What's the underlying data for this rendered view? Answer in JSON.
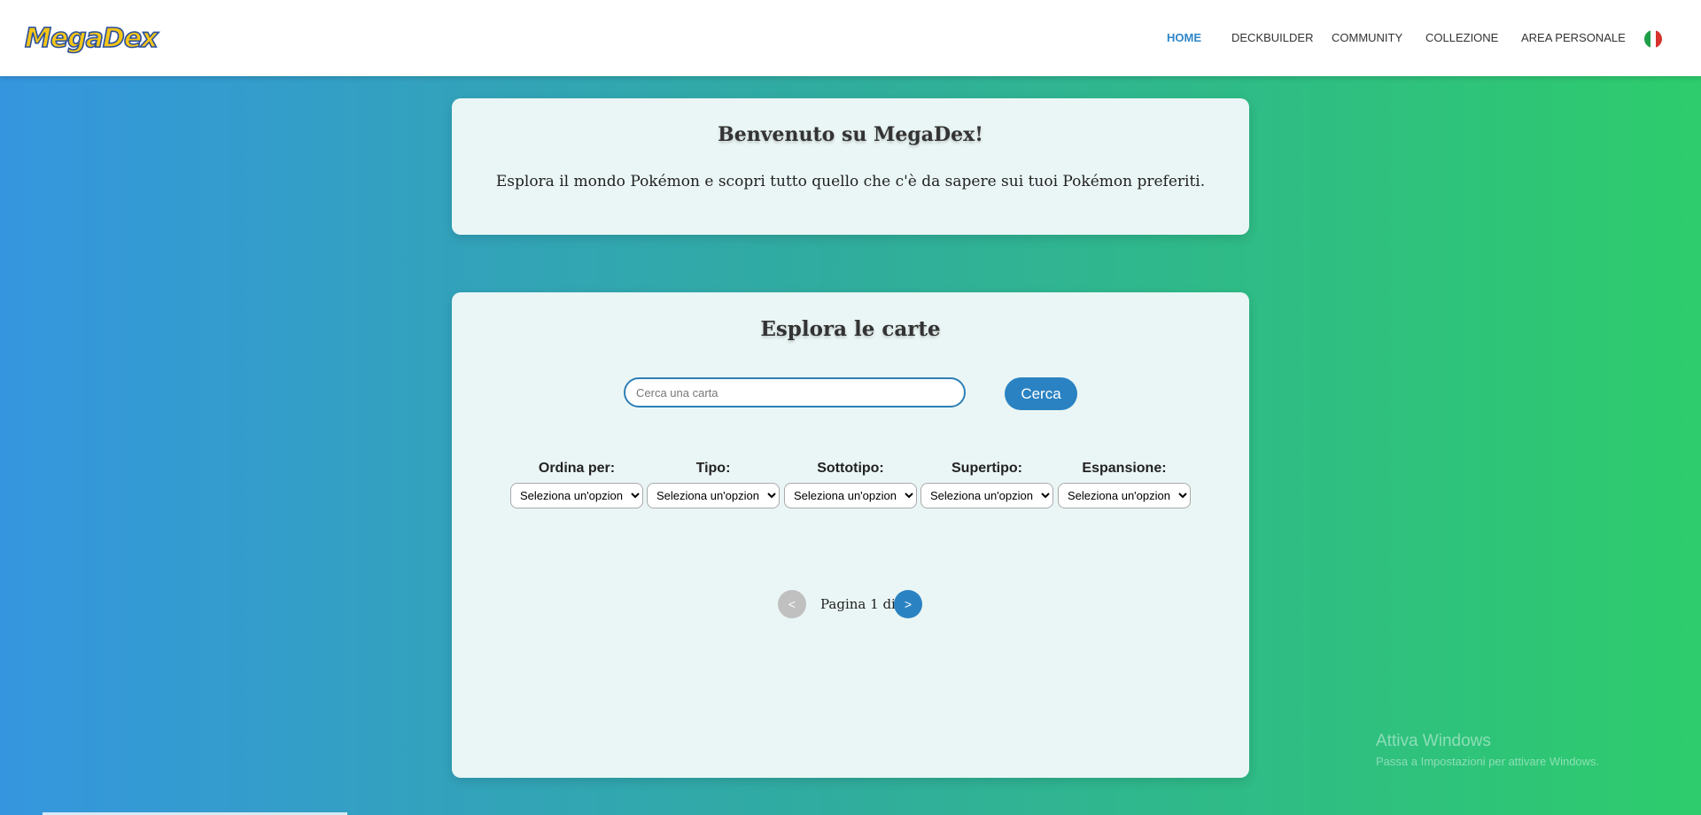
{
  "navbar": {
    "logo": "MegaDex",
    "links": [
      {
        "label": "HOME",
        "active": true
      },
      {
        "label": "DECKBUILDER",
        "active": false
      },
      {
        "label": "COMMUNITY",
        "active": false
      },
      {
        "label": "COLLEZIONE",
        "active": false
      },
      {
        "label": "AREA PERSONALE",
        "active": false
      }
    ],
    "flag_icon": "italy-flag-icon"
  },
  "welcome": {
    "title": "Benvenuto su MegaDex!",
    "text": "Esplora il mondo Pokémon e scopri tutto quello che c'è da sapere sui tuoi Pokémon preferiti."
  },
  "explore": {
    "title": "Esplora le carte",
    "search_placeholder": "Cerca una carta",
    "search_value": "",
    "search_button": "Cerca",
    "filters": [
      {
        "label": "Ordina per:",
        "selected": "Seleziona un'opzione"
      },
      {
        "label": "Tipo:",
        "selected": "Seleziona un'opzione"
      },
      {
        "label": "Sottotipo:",
        "selected": "Seleziona un'opzione"
      },
      {
        "label": "Supertipo:",
        "selected": "Seleziona un'opzione"
      },
      {
        "label": "Espansione:",
        "selected": "Seleziona un'opzione"
      }
    ],
    "pagination": {
      "prev": "<",
      "text": "Pagina 1 di",
      "next": ">"
    }
  },
  "watermark": {
    "title": "Attiva Windows",
    "subtitle": "Passa a Impostazioni per attivare Windows."
  },
  "colors": {
    "accent": "#2a82c2",
    "gradient_start": "#3596df",
    "gradient_end": "#2ecc6c",
    "card_bg": "#eaf6f5"
  }
}
